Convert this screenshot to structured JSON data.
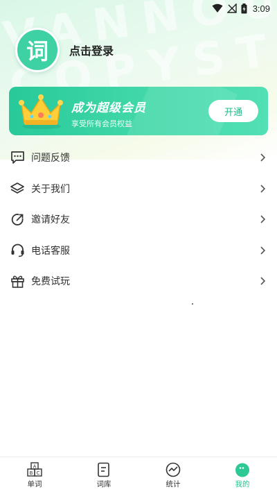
{
  "status_bar": {
    "time": "3:09"
  },
  "header": {
    "avatar_char": "词",
    "login_text": "点击登录",
    "watermark_line1": "VANNOUS",
    "watermark_line2": "COPYSTU"
  },
  "vip": {
    "title": "成为超级会员",
    "subtitle": "享受所有会员权益",
    "button": "开通"
  },
  "menu": [
    {
      "label": "问题反馈",
      "icon": "feedback-icon"
    },
    {
      "label": "关于我们",
      "icon": "layers-icon"
    },
    {
      "label": "邀请好友",
      "icon": "share-icon"
    },
    {
      "label": "电话客服",
      "icon": "headset-icon"
    },
    {
      "label": "免费试玩",
      "icon": "gift-icon"
    }
  ],
  "bottom_nav": {
    "items": [
      {
        "label": "单词",
        "icon": "abc-blocks-icon"
      },
      {
        "label": "词库",
        "icon": "book-icon"
      },
      {
        "label": "统计",
        "icon": "chart-icon"
      },
      {
        "label": "我的",
        "icon": "profile-icon",
        "active": true
      }
    ],
    "active_color": "#24c491"
  },
  "colors": {
    "accent": "#3dd1a3",
    "card_start": "#27c99a",
    "card_end": "#52e0b4"
  }
}
